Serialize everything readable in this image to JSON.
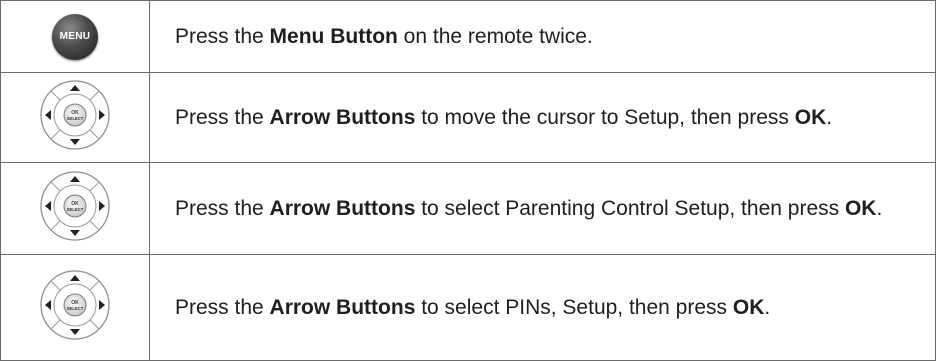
{
  "steps": [
    {
      "icon": "menu-button-icon",
      "icon_label": "MENU",
      "pre": "Press the ",
      "bold1": "Menu Button",
      "mid": " on the remote twice.",
      "bold2": "",
      "post": ""
    },
    {
      "icon": "arrow-pad-icon",
      "icon_label": "",
      "pre": "Press the ",
      "bold1": "Arrow Buttons",
      "mid": " to move the cursor to Setup, then press ",
      "bold2": "OK",
      "post": "."
    },
    {
      "icon": "arrow-pad-icon",
      "icon_label": "",
      "pre": "Press the ",
      "bold1": "Arrow Buttons",
      "mid": " to select Parenting Control Setup, then press ",
      "bold2": "OK",
      "post": "."
    },
    {
      "icon": "arrow-pad-icon",
      "icon_label": "",
      "pre": "Press the ",
      "bold1": "Arrow Buttons",
      "mid": " to select PINs, Setup, then press ",
      "bold2": "OK",
      "post": "."
    }
  ],
  "dpad_center_label": "OK SELECT"
}
